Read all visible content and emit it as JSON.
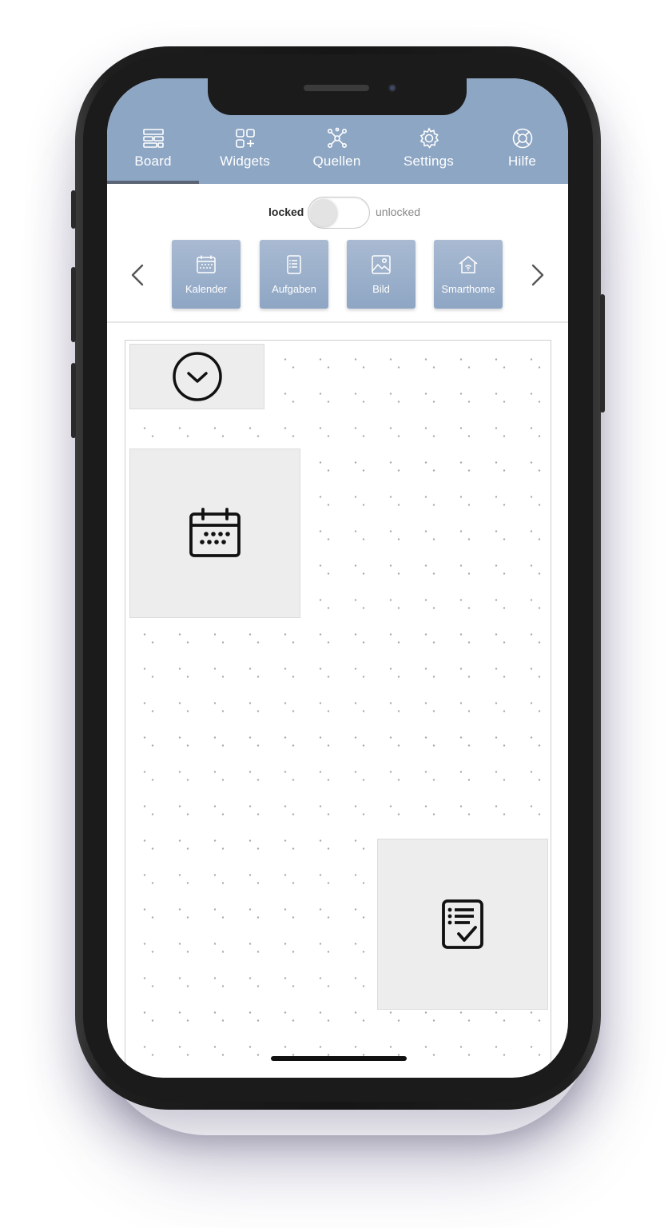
{
  "nav": {
    "items": [
      {
        "label": "Board",
        "icon": "board-icon",
        "active": true
      },
      {
        "label": "Widgets",
        "icon": "widgets-icon"
      },
      {
        "label": "Quellen",
        "icon": "sources-network-icon"
      },
      {
        "label": "Settings",
        "icon": "gear-icon"
      },
      {
        "label": "Hilfe",
        "icon": "lifebuoy-icon"
      }
    ]
  },
  "lock": {
    "locked_label": "locked",
    "unlocked_label": "unlocked",
    "state": "locked"
  },
  "widget_picker": {
    "tiles": [
      {
        "label": "Kalender",
        "icon": "calendar-icon"
      },
      {
        "label": "Aufgaben",
        "icon": "task-list-icon"
      },
      {
        "label": "Bild",
        "icon": "image-icon"
      },
      {
        "label": "Smarthome",
        "icon": "smarthome-icon"
      }
    ]
  },
  "board": {
    "widgets": [
      {
        "type": "clock",
        "icon": "clock-icon"
      },
      {
        "type": "calendar",
        "icon": "calendar-icon"
      },
      {
        "type": "tasks",
        "icon": "task-checklist-icon"
      }
    ]
  },
  "colors": {
    "nav_background": "#8da6c4",
    "active_underline": "#5b6474",
    "widget_background": "#ededed"
  }
}
